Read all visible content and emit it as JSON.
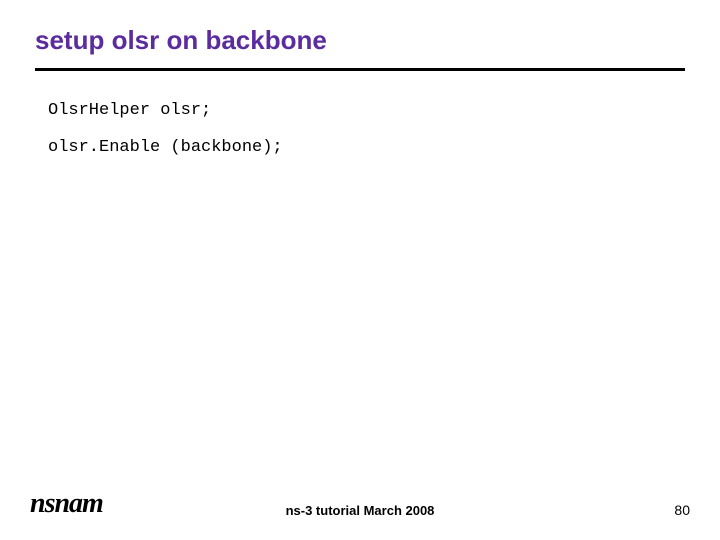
{
  "slide": {
    "title": "setup olsr on backbone",
    "code": {
      "line1": "OlsrHelper olsr;",
      "line2": "olsr.Enable (backbone);"
    }
  },
  "footer": {
    "logo": "nsnam",
    "text": "ns-3 tutorial March 2008",
    "page_number": "80"
  }
}
